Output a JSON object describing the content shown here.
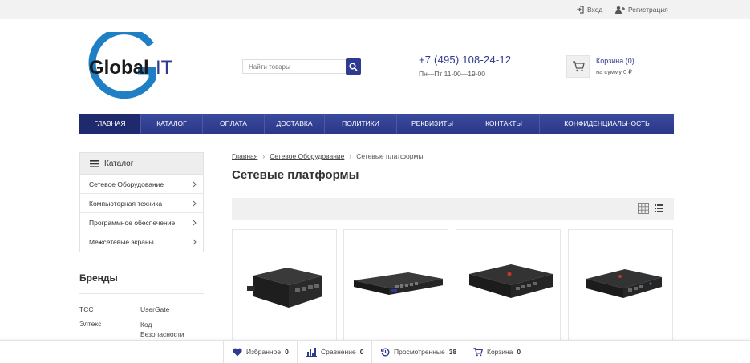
{
  "topbar": {
    "login_label": "Вход",
    "register_label": "Регистрация",
    "login_icon": "sign-in-icon",
    "register_icon": "user-plus-icon"
  },
  "logo": {
    "text_left": "Global",
    "text_right": "IT",
    "brand_color": "#2f3b8f",
    "accent_color": "#1f7fc4"
  },
  "search": {
    "placeholder": "Найти товары",
    "icon": "search-icon"
  },
  "contacts": {
    "phone": "+7 (495) 108-24-12",
    "hours": "Пн—Пт 11-00—19-00"
  },
  "cart": {
    "title": "Корзина (0)",
    "sum": "на сумму 0 ₽",
    "icon": "cart-icon"
  },
  "nav": {
    "items": [
      {
        "label": "Главная",
        "active": true
      },
      {
        "label": "Каталог",
        "active": false
      },
      {
        "label": "Оплата",
        "active": false
      },
      {
        "label": "Доставка",
        "active": false
      },
      {
        "label": "Политики",
        "active": false
      },
      {
        "label": "Реквизиты",
        "active": false
      },
      {
        "label": "Контакты",
        "active": false
      },
      {
        "label": "Конфиденциальность",
        "active": false
      }
    ]
  },
  "sidebar": {
    "catalog_title": "Каталог",
    "items": [
      {
        "label": "Сетевое Оборудование"
      },
      {
        "label": "Компьютерная техника"
      },
      {
        "label": "Программное обеспечение"
      },
      {
        "label": "Межсетевые экраны"
      }
    ]
  },
  "brands": {
    "title": "Бренды",
    "items": [
      "TCC",
      "UserGate",
      "Элтекс",
      "Код Безопасности"
    ]
  },
  "breadcrumb": {
    "home": "Главная",
    "section": "Сетевое Оборудование",
    "current": "Сетевые платформы"
  },
  "page": {
    "title": "Сетевые платформы"
  },
  "view": {
    "grid_icon": "grid-view-icon",
    "list_icon": "list-view-icon"
  },
  "products": [
    {
      "name": "product-1"
    },
    {
      "name": "product-2"
    },
    {
      "name": "product-3"
    },
    {
      "name": "product-4"
    }
  ],
  "bottombar": {
    "favorites_label": "Избранное",
    "favorites_count": "0",
    "compare_label": "Сравнение",
    "compare_count": "0",
    "viewed_label": "Просмотренные",
    "viewed_count": "38",
    "cart_label": "Корзина",
    "cart_count": "0"
  }
}
